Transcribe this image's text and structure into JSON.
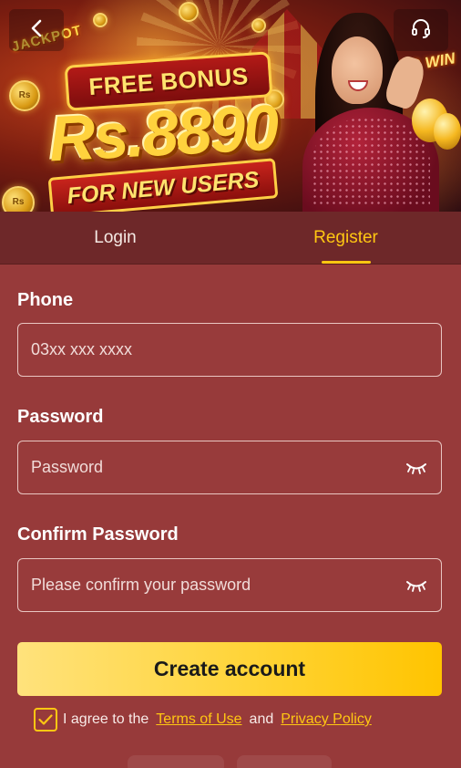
{
  "banner": {
    "headline_top": "FREE BONUS",
    "amount": "Rs.8890",
    "headline_bottom": "FOR NEW USERS",
    "sign_left": "JACKPOT",
    "sign_right": "BIG WIN",
    "coin_mark": "Rs",
    "back_icon": "chevron-left-icon",
    "support_icon": "headset-icon"
  },
  "tabs": [
    {
      "label": "Login",
      "active": false
    },
    {
      "label": "Register",
      "active": true
    }
  ],
  "form": {
    "phone": {
      "label": "Phone",
      "value": "",
      "placeholder": "03xx xxx xxxx"
    },
    "password": {
      "label": "Password",
      "value": "",
      "placeholder": "Password",
      "toggle_icon": "eye-closed-icon"
    },
    "confirm_password": {
      "label": "Confirm Password",
      "value": "",
      "placeholder": "Please confirm your password",
      "toggle_icon": "eye-closed-icon"
    },
    "submit_label": "Create account"
  },
  "agreement": {
    "checked": true,
    "prefix": "I agree to the",
    "terms_link": "Terms of Use",
    "joiner": "and",
    "privacy_link": "Privacy Policy"
  },
  "colors": {
    "background": "#973a3a",
    "tab_bar": "#6e2829",
    "accent": "#ffc712",
    "button_gradient": [
      "#ffe27c",
      "#ffc400"
    ]
  }
}
